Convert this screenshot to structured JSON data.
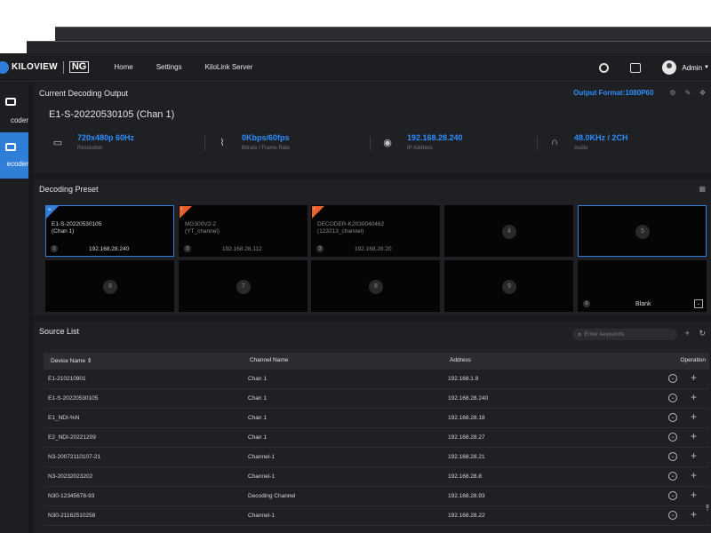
{
  "brand": {
    "logo_text": "KILOVIEW",
    "logo_badge": "NG"
  },
  "nav": {
    "items": [
      "Home",
      "Settings",
      "KiloLink Server"
    ]
  },
  "user": {
    "name": "Admin"
  },
  "sidebar": {
    "items": [
      {
        "label": "coder",
        "icon": "camera-icon"
      },
      {
        "label": "ecoder",
        "icon": "upload-icon",
        "active": true
      }
    ]
  },
  "current_output": {
    "title": "Current Decoding Output",
    "output_format": "Output Format:1080P60",
    "device": "E1-S-20220530105 (Chan 1)",
    "stats": [
      {
        "icon": "monitor-icon",
        "value": "720x480p 60Hz",
        "label": "Resolution"
      },
      {
        "icon": "pulse-icon",
        "value": "0Kbps/60fps",
        "label": "Bitrate / Frame Rate"
      },
      {
        "icon": "location-icon",
        "value": "192.168.28.240",
        "label": "IP Address"
      },
      {
        "icon": "headphones-icon",
        "value": "48.0KHz / 2CH",
        "label": "Audio"
      }
    ]
  },
  "decoding_preset": {
    "title": "Decoding Preset",
    "tiles": [
      {
        "num": "1",
        "name1": "E1-S-20220530105",
        "name2": "(Chan 1)",
        "ip": "192.168.28.240",
        "state": "active"
      },
      {
        "num": "2",
        "name1": "MG300V2-2",
        "name2": "(YT_channel)",
        "ip": "192.168.28.112",
        "state": "offline"
      },
      {
        "num": "3",
        "name1": "DECODER-K2030040462",
        "name2": "(123213_channel)",
        "ip": "192.168.28.20",
        "state": "offline"
      },
      {
        "num": "4",
        "state": "empty"
      },
      {
        "num": "5",
        "state": "empty-selected"
      },
      {
        "num": "6",
        "state": "empty"
      },
      {
        "num": "7",
        "state": "empty"
      },
      {
        "num": "8",
        "state": "empty"
      },
      {
        "num": "9",
        "state": "empty"
      },
      {
        "num": "0",
        "label": "Blank",
        "state": "blank"
      }
    ]
  },
  "source_list": {
    "title": "Source List",
    "search_placeholder": "Enter keywords",
    "columns": [
      "Device Name",
      "Channel Name",
      "Address",
      "Operation"
    ],
    "rows": [
      [
        "E1-210210901",
        "Chan 1",
        "192.168.1.8"
      ],
      [
        "E1-S-20220530105",
        "Chan 1",
        "192.168.28.240"
      ],
      [
        "E1_NDI-%N",
        "Chan 1",
        "192.168.28.18"
      ],
      [
        "E2_NDI-20221209",
        "Chan 1",
        "192.168.28.27"
      ],
      [
        "N3-20072110107-21",
        "Channel-1",
        "192.168.28.21"
      ],
      [
        "N3-20232023202",
        "Channel-1",
        "192.168.28.8"
      ],
      [
        "N30-12345678-93",
        "Decoding Channel",
        "192.168.28.93"
      ],
      [
        "N30-21162510258",
        "Channel-1",
        "192.168.28.22"
      ]
    ]
  }
}
